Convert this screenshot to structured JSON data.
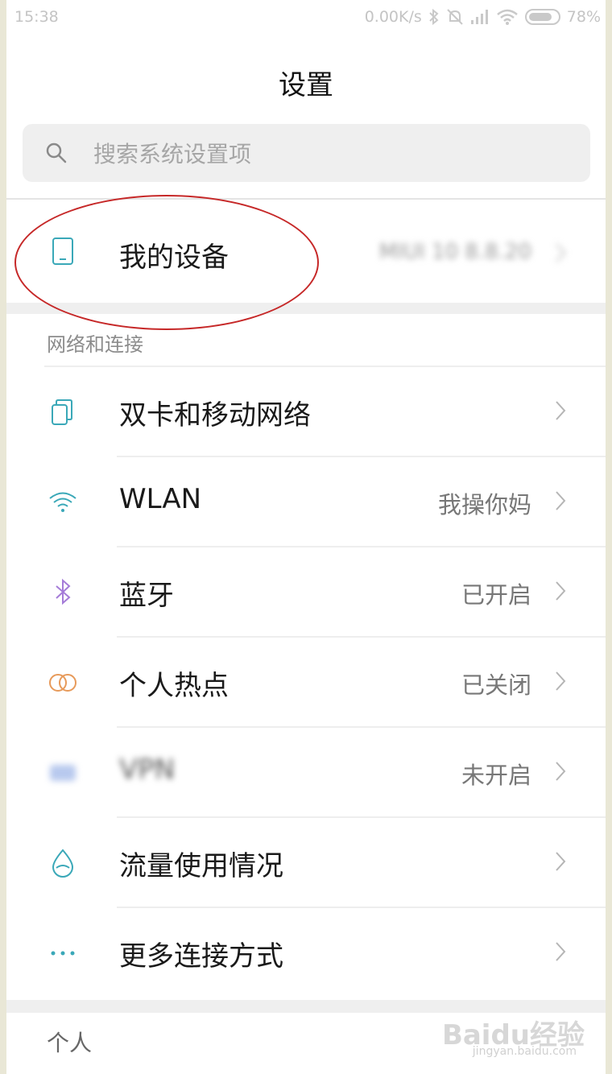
{
  "status_bar": {
    "time": "15:38",
    "speed": "0.00K/s",
    "battery": "78%",
    "icons": [
      "bluetooth-icon",
      "silent-icon",
      "signal-icon",
      "wifi-icon",
      "battery-icon"
    ]
  },
  "header": {
    "title": "设置"
  },
  "search": {
    "placeholder": "搜索系统设置项"
  },
  "device": {
    "label": "我的设备",
    "value": "MIUI 10 8.8.20"
  },
  "network_section": {
    "header": "网络和连接",
    "items": [
      {
        "label": "双卡和移动网络",
        "value": "",
        "icon": "dual-sim-icon"
      },
      {
        "label": "WLAN",
        "value": "我操你妈",
        "icon": "wifi-icon"
      },
      {
        "label": "蓝牙",
        "value": "已开启",
        "icon": "bluetooth-icon"
      },
      {
        "label": "个人热点",
        "value": "已关闭",
        "icon": "hotspot-icon"
      },
      {
        "label": "VPN",
        "value": "未开启",
        "icon": "vpn-icon"
      },
      {
        "label": "流量使用情况",
        "value": "",
        "icon": "data-usage-icon"
      },
      {
        "label": "更多连接方式",
        "value": "",
        "icon": "more-icon"
      }
    ]
  },
  "personal_section": {
    "header": "个人"
  },
  "watermark": {
    "brand": "Baidu经验",
    "url": "jingyan.baidu.com"
  },
  "colors": {
    "annotation_circle": "#c62828",
    "teal_icon": "#3aa8b8",
    "bluetooth_icon": "#a57cd8",
    "hotspot_icon": "#e79a5a"
  }
}
